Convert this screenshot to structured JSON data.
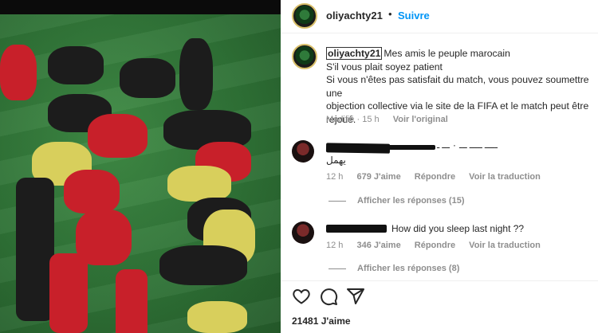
{
  "post": {
    "username": "oliyachty21",
    "follow_label": "Suivre",
    "separator": "•"
  },
  "caption": {
    "username": "oliyachty21",
    "lines": [
      "Mes amis le peuple marocain",
      "S'il vous plait soyez patient",
      "Si vous n'êtes pas satisfait du match, vous pouvez soumettre une",
      "objection collective via le site de la FIFA et le match peut être",
      "rejoué."
    ],
    "edited_label": "Modifié · 15 h",
    "see_original_label": "Voir l'original"
  },
  "comments": [
    {
      "text_line1": "ـــــ ـــــ ـــ ٠ ـــ ـ",
      "text_line2": "يهمل",
      "time": "12 h",
      "likes": "679 J'aime",
      "reply_label": "Répondre",
      "translate_label": "Voir la traduction",
      "view_replies_label": "Afficher les réponses (15)"
    },
    {
      "text_line1": "How did you sleep last night ??",
      "time": "12 h",
      "likes": "346 J'aime",
      "reply_label": "Répondre",
      "translate_label": "Voir la traduction",
      "view_replies_label": "Afficher les réponses (8)"
    }
  ],
  "actions": {
    "like_icon": "heart-icon",
    "comment_icon": "comment-icon",
    "share_icon": "send-icon"
  },
  "likes_label": "21481 J'aime",
  "colors": {
    "accent": "#0095f6",
    "secondary_text": "#8e8e8e",
    "pitch": "#2f7236",
    "jersey_red": "#c8202a"
  }
}
